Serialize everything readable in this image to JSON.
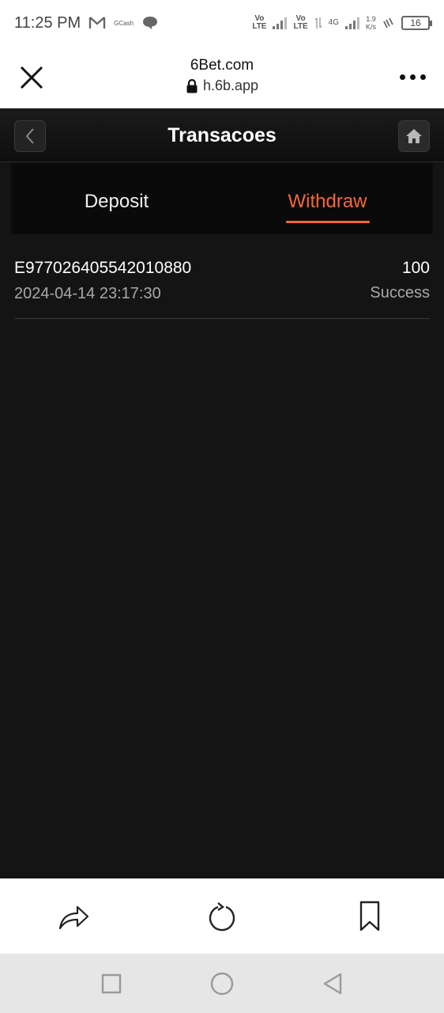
{
  "status_bar": {
    "time": "11:25 PM",
    "gcash_label": "GCash",
    "volte_1": "Vo\nLTE",
    "volte_2": "Vo\nLTE",
    "network_type": "4G",
    "net_speed": "1.9\nK/s",
    "battery": "16"
  },
  "browser": {
    "site_title": "6Bet.com",
    "site_url": "h.6b.app"
  },
  "header": {
    "title": "Transacoes"
  },
  "tabs": [
    {
      "label": "Deposit",
      "active": false
    },
    {
      "label": "Withdraw",
      "active": true
    }
  ],
  "transactions": [
    {
      "id": "E977026405542010880",
      "date": "2024-04-14 23:17:30",
      "amount": "100",
      "status": "Success"
    }
  ],
  "colors": {
    "accent": "#f4683b",
    "background": "#141414"
  }
}
